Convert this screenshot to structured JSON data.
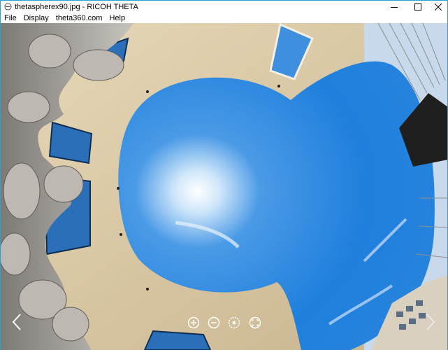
{
  "window": {
    "title": "thetaspherex90.jpg - RICOH THETA",
    "buttons": {
      "minimize_icon": "minimize-icon",
      "maximize_icon": "maximize-icon",
      "close_icon": "close-icon"
    },
    "accent_color": "#2b9fd8"
  },
  "menu": {
    "items": [
      {
        "label": "File"
      },
      {
        "label": "Display"
      },
      {
        "label": "theta360.com"
      },
      {
        "label": "Help"
      }
    ]
  },
  "viewer": {
    "image_kind": "spherical-photo",
    "sky_color": "#1f7fdc",
    "wall_color": "#d8c9a8",
    "controls": [
      {
        "icon": "zoom-in-icon"
      },
      {
        "icon": "zoom-out-icon"
      },
      {
        "icon": "auto-rotate-icon"
      },
      {
        "icon": "fullscreen-icon"
      }
    ],
    "nav": {
      "prev_icon": "chevron-left-icon",
      "next_icon": "chevron-right-icon"
    }
  }
}
